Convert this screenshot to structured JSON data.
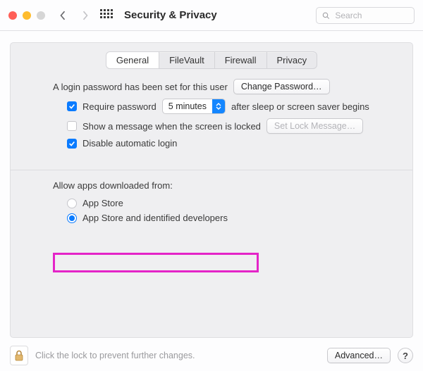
{
  "window": {
    "title": "Security & Privacy"
  },
  "search": {
    "placeholder": "Search"
  },
  "tabs": {
    "general": "General",
    "filevault": "FileVault",
    "firewall": "Firewall",
    "privacy": "Privacy"
  },
  "login": {
    "password_set": "A login password has been set for this user",
    "change_password": "Change Password…",
    "require_password": "Require password",
    "interval_selected": "5 minutes",
    "after_sleep": "after sleep or screen saver begins",
    "show_message": "Show a message when the screen is locked",
    "set_lock_message": "Set Lock Message…",
    "disable_auto_login": "Disable automatic login"
  },
  "gatekeeper": {
    "section_label": "Allow apps downloaded from:",
    "app_store": "App Store",
    "identified": "App Store and identified developers"
  },
  "footer": {
    "lock_hint": "Click the lock to prevent further changes.",
    "advanced": "Advanced…",
    "help": "?"
  }
}
